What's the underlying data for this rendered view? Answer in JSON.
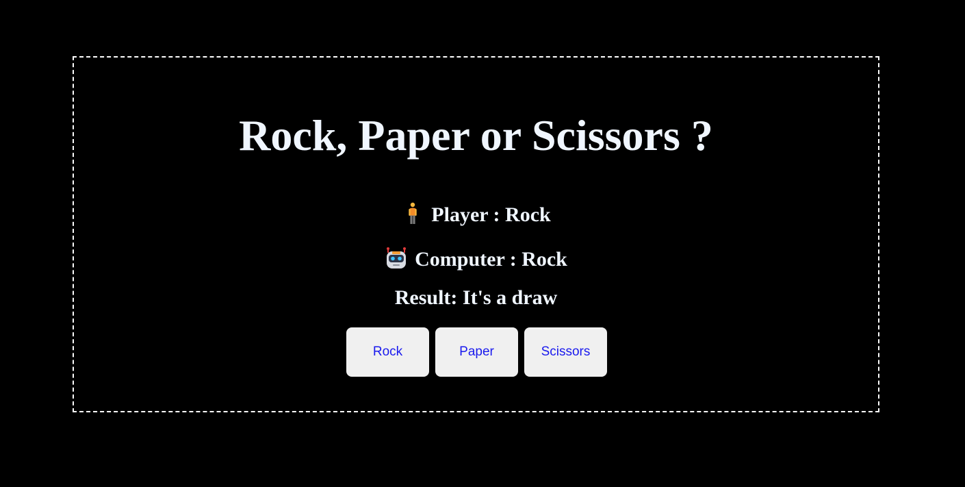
{
  "game": {
    "title": "Rock, Paper or Scissors ?",
    "player": {
      "icon": "person-standing-icon",
      "text": "Player : Rock"
    },
    "computer": {
      "icon": "robot-icon",
      "text": "Computer : Rock"
    },
    "result": {
      "text": "Result: It's a draw"
    },
    "buttons": [
      {
        "label": "Rock"
      },
      {
        "label": "Paper"
      },
      {
        "label": "Scissors"
      }
    ]
  },
  "colors": {
    "background": "#000000",
    "text": "#f0f6ff",
    "border": "#ffffff",
    "button_bg": "#f0f0f0",
    "button_text": "#1a1aee"
  }
}
